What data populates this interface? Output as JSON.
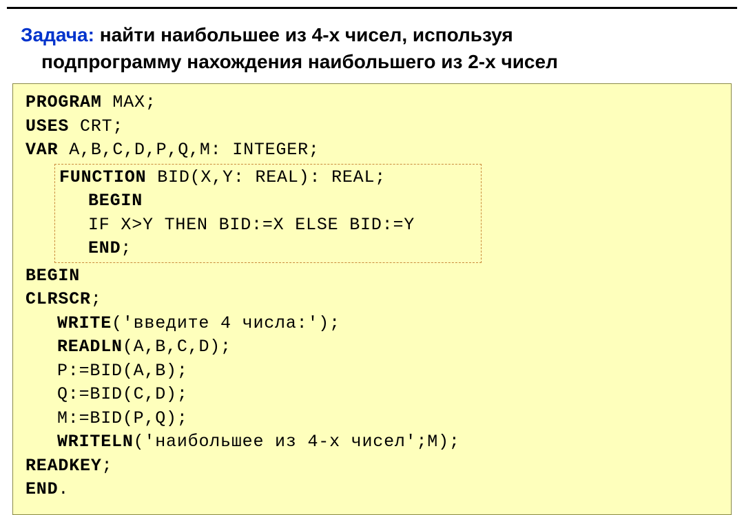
{
  "task": {
    "label": "Задача:",
    "line1": "  найти  наибольшее  из  4-х  чисел,  используя",
    "line2": "подпрограмму нахождения наибольшего из 2-х чисел"
  },
  "code": {
    "l1_kw": "PROGRAM",
    "l1_rest": " MAX;",
    "l2_kw": "USES",
    "l2_rest": " CRT;",
    "l3_kw": "VAR",
    "l3_rest": " A,B,C,D,P,Q,M: INTEGER;",
    "func": {
      "f1_kw": "FUNCTION",
      "f1_rest": " BID(X,Y: REAL): REAL;",
      "f2_kw": "BEGIN",
      "f3": "IF X>Y THEN BID:=X ELSE BID:=Y",
      "f4_kw": "END",
      "f4_rest": ";"
    },
    "l4_kw": "BEGIN",
    "l5_kw": "CLRSCR",
    "l5_rest": ";",
    "l6_kw": "WRITE",
    "l6_rest": "('введите 4 числа:');",
    "l7_kw": "READLN",
    "l7_rest": "(A,B,C,D);",
    "l8": "P:=BID(A,B);",
    "l9": "Q:=BID(C,D);",
    "l10": "M:=BID(P,Q);",
    "l11_kw": "WRITELN",
    "l11_rest": "('наибольшее из 4-х чисел';M);",
    "l12_kw": "READKEY",
    "l12_rest": ";",
    "l13_kw": "END",
    "l13_rest": "."
  }
}
